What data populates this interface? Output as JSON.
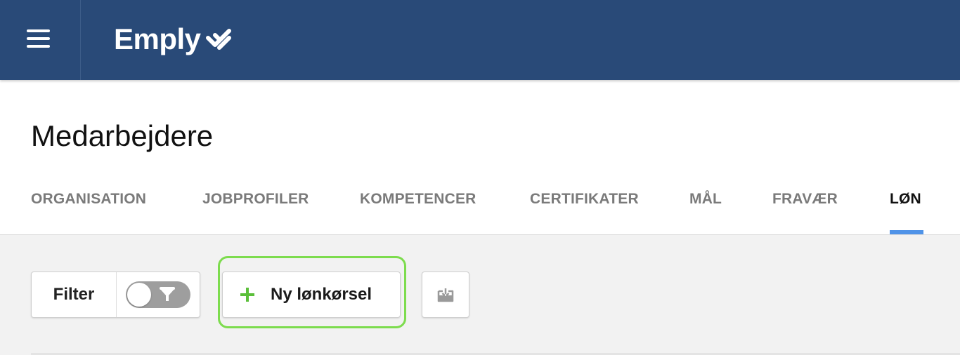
{
  "app": {
    "logo_text": "Emply",
    "brand_color": "#294a78",
    "icons": {
      "menu": "hamburger-menu-icon",
      "logo_mark": "emply-chevron-mark-icon"
    }
  },
  "page": {
    "title": "Medarbejdere"
  },
  "tabs": [
    {
      "label": "ORGANISATION",
      "active": false
    },
    {
      "label": "JOBPROFILER",
      "active": false
    },
    {
      "label": "KOMPETENCER",
      "active": false
    },
    {
      "label": "CERTIFIKATER",
      "active": false
    },
    {
      "label": "MÅL",
      "active": false
    },
    {
      "label": "FRAVÆR",
      "active": false
    },
    {
      "label": "LØN",
      "active": true
    }
  ],
  "active_tab_color": "#4f93e8",
  "toolbar": {
    "filter_label": "Filter",
    "filter_toggle_on": false,
    "filter_icon": "funnel-filter-icon",
    "new_run_label": "Ny lønkørsel",
    "new_run_icon": "plus-icon",
    "new_run_accent": "#5bbf3a",
    "highlight_color": "#7ddc4e",
    "export_icon": "download-tray-icon"
  }
}
